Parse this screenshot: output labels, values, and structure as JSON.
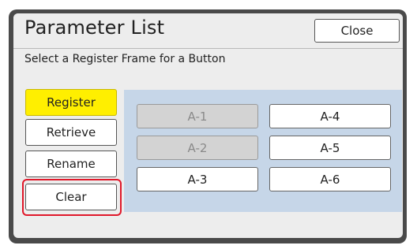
{
  "window": {
    "title": "Parameter List",
    "close_label": "Close",
    "instruction": "Select a Register Frame for a Button"
  },
  "actions": [
    {
      "label": "Register",
      "state": "active"
    },
    {
      "label": "Retrieve",
      "state": "normal"
    },
    {
      "label": "Rename",
      "state": "normal"
    },
    {
      "label": "Clear",
      "state": "highlighted"
    }
  ],
  "slots": [
    {
      "label": "A-1",
      "enabled": false
    },
    {
      "label": "A-2",
      "enabled": false
    },
    {
      "label": "A-3",
      "enabled": true
    },
    {
      "label": "A-4",
      "enabled": true
    },
    {
      "label": "A-5",
      "enabled": true
    },
    {
      "label": "A-6",
      "enabled": true
    }
  ],
  "colors": {
    "active_button": "#ffef00",
    "highlight_outline": "#e0182a",
    "slot_area": "#c6d6e8",
    "disabled_slot": "#d3d3d3"
  }
}
